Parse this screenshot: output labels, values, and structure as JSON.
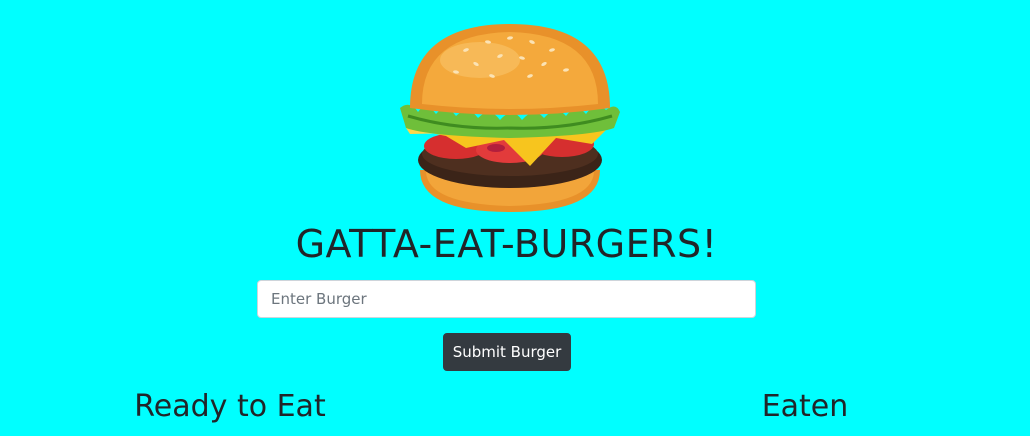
{
  "header": {
    "logo_icon": "burger-icon",
    "title": "GATTA-EAT-BURGERS!"
  },
  "form": {
    "input_placeholder": "Enter Burger",
    "input_value": "",
    "submit_label": "Submit Burger"
  },
  "columns": {
    "ready_heading": "Ready to Eat",
    "eaten_heading": "Eaten"
  },
  "colors": {
    "background": "#00ffff",
    "button": "#343a40",
    "text": "#212529"
  }
}
